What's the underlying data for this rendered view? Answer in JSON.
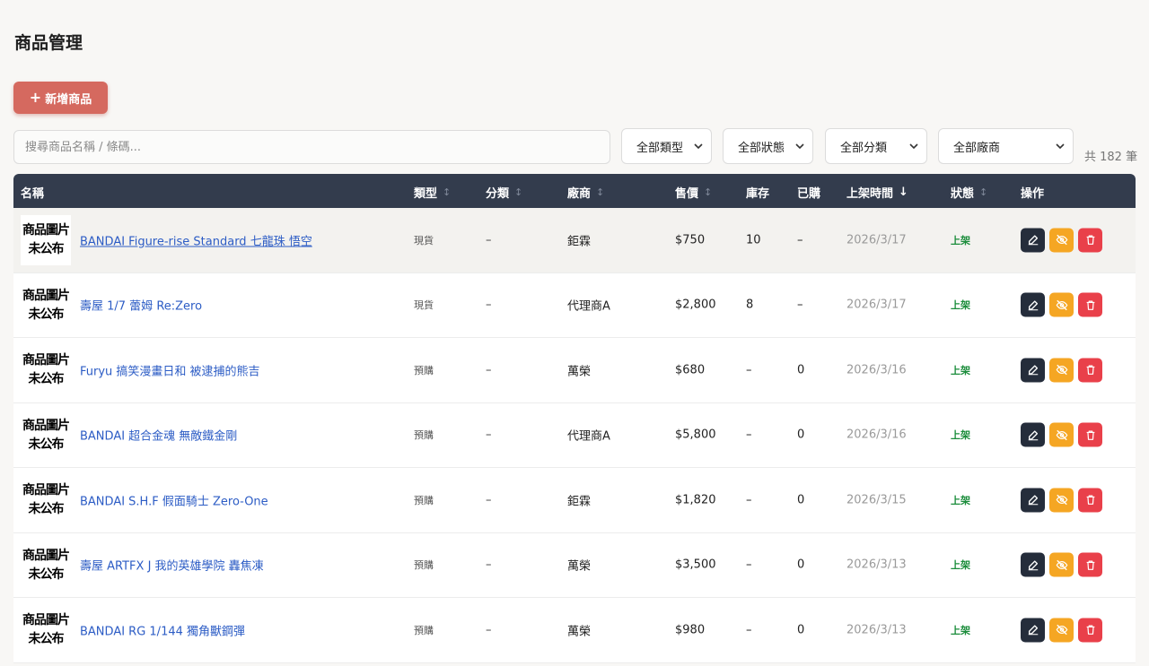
{
  "page": {
    "title": "商品管理"
  },
  "toolbar": {
    "add_label": "新增商品"
  },
  "search": {
    "placeholder": "搜尋商品名稱 / 條碼..."
  },
  "filters": {
    "type": "全部類型",
    "status": "全部狀態",
    "category": "全部分類",
    "vendor": "全部廠商",
    "count": "共 182 筆"
  },
  "table": {
    "headers": {
      "name": "名稱",
      "type": "類型",
      "category": "分類",
      "vendor": "廠商",
      "price": "售價",
      "stock": "庫存",
      "ordered": "已購",
      "listed": "上架時間",
      "status": "狀態",
      "actions": "操作"
    },
    "sort_idle": "↕",
    "sort_active": "↓",
    "thumb_text": [
      "商品圖片",
      "未公布"
    ],
    "rows": [
      {
        "name": "BANDAI Figure-rise Standard 七龍珠 悟空",
        "type": "現貨",
        "category": "–",
        "vendor": "鉅霖",
        "price": "$750",
        "stock": "10",
        "ordered": "–",
        "listed": "2026/3/17",
        "status": "上架"
      },
      {
        "name": "壽屋 1/7 蕾姆 Re:Zero",
        "type": "現貨",
        "category": "–",
        "vendor": "代理商A",
        "price": "$2,800",
        "stock": "8",
        "ordered": "–",
        "listed": "2026/3/17",
        "status": "上架"
      },
      {
        "name": "Furyu 搞笑漫畫日和 被逮捕的熊吉",
        "type": "預購",
        "category": "–",
        "vendor": "萬榮",
        "price": "$680",
        "stock": "–",
        "ordered": "0",
        "listed": "2026/3/16",
        "status": "上架"
      },
      {
        "name": "BANDAI 超合金魂 無敵鐵金剛",
        "type": "預購",
        "category": "–",
        "vendor": "代理商A",
        "price": "$5,800",
        "stock": "–",
        "ordered": "0",
        "listed": "2026/3/16",
        "status": "上架"
      },
      {
        "name": "BANDAI S.H.F 假面騎士 Zero-One",
        "type": "預購",
        "category": "–",
        "vendor": "鉅霖",
        "price": "$1,820",
        "stock": "–",
        "ordered": "0",
        "listed": "2026/3/15",
        "status": "上架"
      },
      {
        "name": "壽屋 ARTFX J 我的英雄學院 轟焦凍",
        "type": "預購",
        "category": "–",
        "vendor": "萬榮",
        "price": "$3,500",
        "stock": "–",
        "ordered": "0",
        "listed": "2026/3/13",
        "status": "上架"
      },
      {
        "name": "BANDAI RG 1/144 獨角獸鋼彈",
        "type": "預購",
        "category": "–",
        "vendor": "萬榮",
        "price": "$980",
        "stock": "–",
        "ordered": "0",
        "listed": "2026/3/13",
        "status": "上架"
      }
    ]
  },
  "colors": {
    "accent": "#d5695f",
    "header_bg": "#333c4d",
    "link": "#2c5cc5",
    "status_on": "#1a8c3a",
    "edit_btn": "#252d3b",
    "hide_btn": "#f5a623",
    "delete_btn": "#e9404a"
  },
  "icons": {
    "add": "plus-icon",
    "select": "chevron-down-icon",
    "edit": "edit-icon",
    "hide": "eye-off-icon",
    "delete": "trash-icon"
  }
}
